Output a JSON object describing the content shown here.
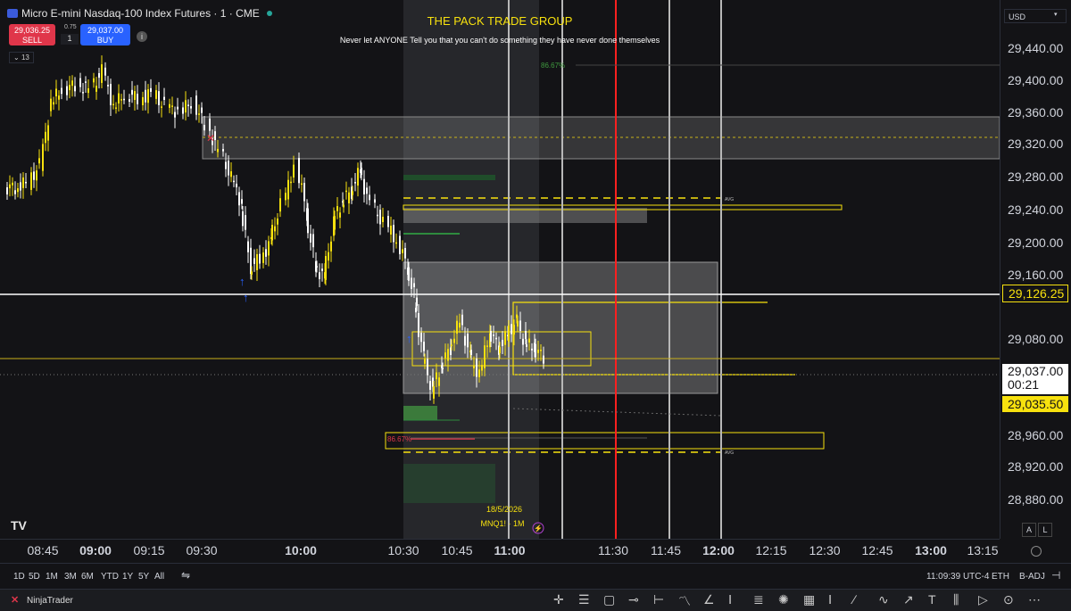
{
  "header": {
    "symbol": "Micro E-mini Nasdaq-100 Index Futures · 1 · CME",
    "sell_price": "29,036.25",
    "sell_label": "SELL",
    "spread": "0.75",
    "quantity": "1",
    "buy_price": "29,037.00",
    "buy_label": "BUY",
    "indicator_count": "13",
    "info": "i"
  },
  "overlay": {
    "title": "THE PACK TRADE GROUP",
    "subtitle": "Never let ANYONE Tell you that you can't do something they have never done themselves",
    "pct_top": "86.67%",
    "pct_bottom": "86.67%",
    "avg_top": "AVG",
    "avg_bottom": "AVG",
    "date_label": "18/5/2026",
    "contract_label": "MNQ1! · 1M",
    "logo": "TV"
  },
  "price_axis": {
    "currency": "USD",
    "ticks": [
      "29,440.00",
      "29,400.00",
      "29,360.00",
      "29,320.00",
      "29,280.00",
      "29,240.00",
      "29,200.00",
      "29,160.00",
      "29,080.00",
      "28,960.00",
      "28,920.00",
      "28,880.00"
    ],
    "tag_white": "29,126.25",
    "tag_current": "29,037.00",
    "tag_countdown": "00:21",
    "tag_yellow": "29,035.50",
    "btn_a": "A",
    "btn_l": "L"
  },
  "time_axis": {
    "ticks": [
      "08:45",
      "09:00",
      "09:15",
      "09:30",
      "10:00",
      "10:30",
      "10:45",
      "11:00",
      "11:30",
      "11:45",
      "12:00",
      "12:15",
      "12:30",
      "12:45",
      "13:00",
      "13:15"
    ]
  },
  "range_bar": {
    "ranges": [
      "1D",
      "5D",
      "1M",
      "3M",
      "6M",
      "YTD",
      "1Y",
      "5Y",
      "All"
    ],
    "clock": "11:09:39 UTC-4",
    "session": "ETH",
    "adjust": "B-ADJ"
  },
  "footer": {
    "brand": "NinjaTrader",
    "tools": [
      "crosshair-icon",
      "horizontal-lines-icon",
      "rectangle-icon",
      "ray-icon",
      "measure-icon",
      "path-icon",
      "brush-icon",
      "text-tool-icon",
      "fib-icon",
      "gann-icon",
      "pattern-icon",
      "grid-icon",
      "vertical-line-icon",
      "trend-line-icon",
      "channel-icon",
      "arrow-icon",
      "text-icon",
      "volume-icon",
      "replay-icon",
      "more-icon"
    ]
  },
  "colors": {
    "background": "#131316",
    "accent_yellow": "#f7e10e",
    "bull": "#f7e10e",
    "bear": "#ffffff",
    "sell": "#e0364a",
    "buy": "#2962ff",
    "red_line": "#ff2020"
  }
}
